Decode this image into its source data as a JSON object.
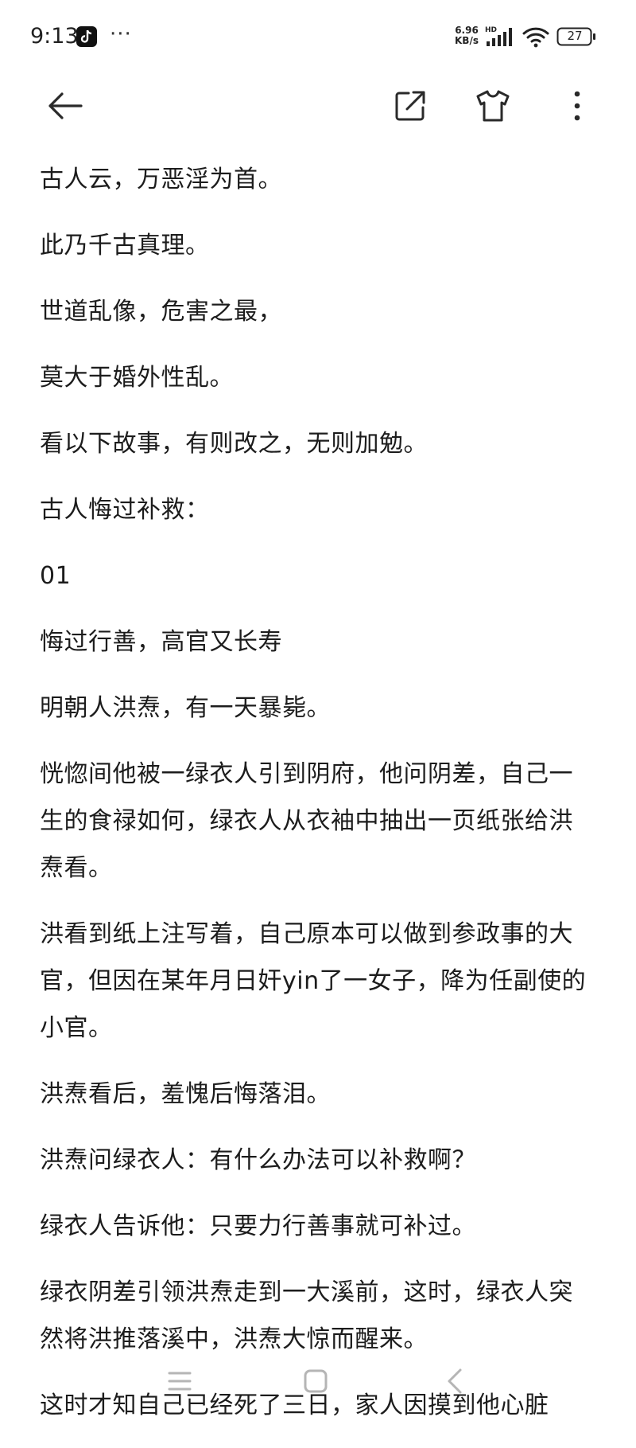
{
  "status_bar": {
    "time": "9:13",
    "more": "···",
    "net_speed_value": "6.96",
    "net_speed_unit": "KB/s",
    "network_label": "HD",
    "battery": "27"
  },
  "toolbar": {
    "back_icon": "arrow-left",
    "share_icon": "share-external",
    "theme_icon": "t-shirt",
    "more_icon": "more-vertical"
  },
  "article": {
    "paragraphs": [
      "古人云，万恶淫为首。",
      "此乃千古真理。",
      "世道乱像，危害之最，",
      "莫大于婚外性乱。",
      "看以下故事，有则改之，无则加勉。",
      "古人悔过补救：",
      "01",
      "悔过行善，高官又长寿",
      "明朝人洪焘，有一天暴毙。",
      "恍惚间他被一绿衣人引到阴府，他问阴差，自己一生的食禄如何，绿衣人从衣袖中抽出一页纸张给洪焘看。",
      "洪看到纸上注写着，自己原本可以做到参政事的大官，但因在某年月日奸yin了一女子，降为任副使的小官。",
      "洪焘看后，羞愧后悔落泪。",
      "洪焘问绿衣人：有什么办法可以补救啊？",
      "绿衣人告诉他：只要力行善事就可补过。",
      "绿衣阴差引领洪焘走到一大溪前，这时，绿衣人突然将洪推落溪中，洪焘大惊而醒来。",
      "这时才知自己已经死了三日，家人因摸到他心脏"
    ]
  },
  "nav_bar": {
    "menu_icon": "menu-lines",
    "home_icon": "square-home",
    "back_icon": "chevron-left"
  },
  "colors": {
    "text": "#1c1c1c",
    "icon": "#2a2a2a",
    "nav_icon": "#b5b5b5",
    "background": "#ffffff"
  }
}
